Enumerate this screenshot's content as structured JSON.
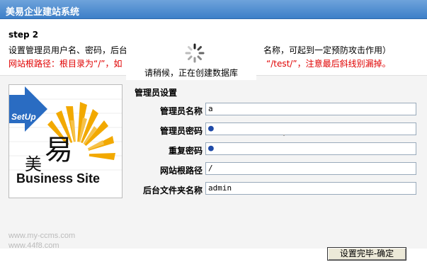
{
  "window": {
    "title": "美易企业建站系统"
  },
  "info": {
    "step": "step 2",
    "description_start": "设置管理员用户名、密码，后台",
    "description_end": "名称，可起到一定预防攻击作用）",
    "warning_start": "网站根路径：根目录为“/”，如",
    "warning_end": "“/test/”，注意最后斜线别漏掉。"
  },
  "loading": {
    "text": "请稍候，正在创建数据库"
  },
  "logo": {
    "badge": "SetUp",
    "brand_cn_1": "美",
    "brand_cn_2": "易",
    "brand_en": "Business Site"
  },
  "form": {
    "section_title": "管理员设置",
    "fields": [
      {
        "label": "管理员名称",
        "value": "a"
      },
      {
        "label": "管理员密码",
        "value": "●"
      },
      {
        "label": "重复密码",
        "value": "●"
      },
      {
        "label": "网站根路径",
        "value": "/"
      },
      {
        "label": "后台文件夹名称",
        "value": "admin"
      }
    ],
    "submit_label": "设置完毕-确定"
  },
  "footer": {
    "url1": "www.my-ccms.com",
    "url2": "www.44f8.com"
  },
  "colors": {
    "titlebar": "#3d7fc8",
    "warning": "#e00000",
    "badge": "#2a6cc2",
    "sun": "#f2a900"
  }
}
